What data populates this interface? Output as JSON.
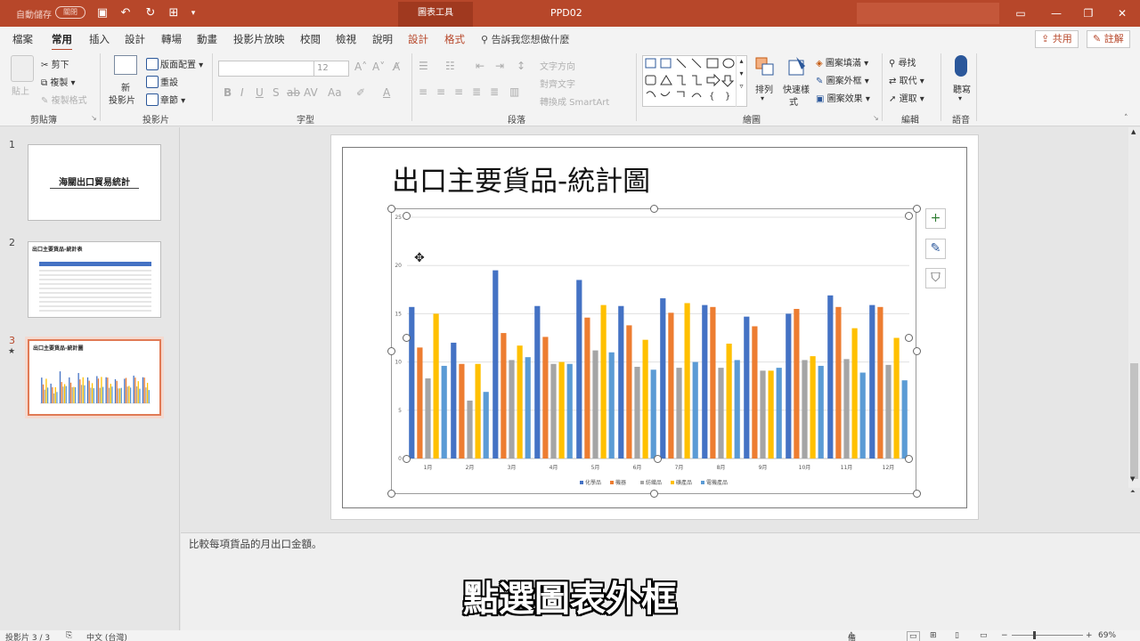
{
  "titlebar": {
    "autosave": "自動儲存",
    "autosave_state": "關閉",
    "context_tab": "圖表工具",
    "doc_title": "PPD02"
  },
  "menu": {
    "tabs": [
      "檔案",
      "常用",
      "插入",
      "設計",
      "轉場",
      "動畫",
      "投影片放映",
      "校閱",
      "檢視",
      "說明",
      "設計",
      "格式"
    ],
    "active": "常用",
    "tell_me": "告訴我您想做什麼",
    "share": "共用",
    "comment": "註解"
  },
  "ribbon": {
    "clipboard": {
      "paste": "貼上",
      "cut": "剪下",
      "copy": "複製",
      "format_painter": "複製格式",
      "label": "剪貼簿"
    },
    "slides": {
      "new_slide_1": "新",
      "new_slide_2": "投影片",
      "layout": "版面配置",
      "reset": "重設",
      "section": "章節",
      "label": "投影片"
    },
    "font": {
      "size": "12",
      "label": "字型"
    },
    "paragraph": {
      "text_direction": "文字方向",
      "align_text": "對齊文字",
      "smartart": "轉換成 SmartArt",
      "label": "段落"
    },
    "drawing": {
      "arrange": "排列",
      "quick_styles_1": "快速樣",
      "quick_styles_2": "式",
      "shape_fill": "圖案填滿",
      "shape_outline": "圖案外框",
      "shape_effects": "圖案效果",
      "label": "繪圖"
    },
    "editing": {
      "find": "尋找",
      "replace": "取代",
      "select": "選取",
      "label": "編輯"
    },
    "voice": {
      "dictate": "聽寫",
      "label": "語音"
    }
  },
  "thumbnails": [
    {
      "num": "1",
      "title": "海關出口貿易統計"
    },
    {
      "num": "2",
      "title": "出口主要貨品-統計表"
    },
    {
      "num": "3",
      "title": "出口主要貨品-統計圖"
    }
  ],
  "slide": {
    "title": "出口主要貨品-統計圖"
  },
  "chart_data": {
    "type": "bar",
    "categories": [
      "1月",
      "2月",
      "3月",
      "4月",
      "5月",
      "6月",
      "7月",
      "8月",
      "9月",
      "10月",
      "11月",
      "12月"
    ],
    "series": [
      {
        "name": "化學品",
        "color": "#4472c4",
        "values": [
          15.7,
          12.0,
          19.5,
          15.8,
          18.5,
          15.8,
          16.6,
          15.9,
          14.7,
          15.0,
          16.9,
          15.9
        ]
      },
      {
        "name": "機器",
        "color": "#ed7d31",
        "values": [
          11.5,
          9.8,
          13.0,
          12.6,
          14.6,
          13.8,
          15.1,
          15.7,
          13.7,
          15.5,
          15.7,
          15.7
        ]
      },
      {
        "name": "紡織品",
        "color": "#a5a5a5",
        "values": [
          8.3,
          6.0,
          10.2,
          9.8,
          11.2,
          9.5,
          9.4,
          9.4,
          9.1,
          10.2,
          10.3,
          9.7
        ]
      },
      {
        "name": "礦產品",
        "color": "#ffc000",
        "values": [
          15.0,
          9.8,
          11.7,
          10.0,
          15.9,
          12.3,
          16.1,
          11.9,
          9.1,
          10.6,
          13.5,
          12.5
        ]
      },
      {
        "name": "電機產品",
        "color": "#5b9bd5",
        "values": [
          9.6,
          6.9,
          10.5,
          9.8,
          11.0,
          9.2,
          10.0,
          10.2,
          9.4,
          9.6,
          8.9,
          8.1
        ]
      }
    ],
    "ylim": [
      0,
      25
    ],
    "yticks": [
      "0",
      "5",
      "10",
      "15",
      "20",
      "25"
    ],
    "grid": true,
    "legend": "bottom"
  },
  "notes": "比較每項貨品的月出口金額。",
  "subtitle": "點選圖表外框",
  "statusbar": {
    "slide_of": "投影片 3 / 3",
    "language": "中文 (台灣)",
    "notes_btn": "備忘稿",
    "zoom": "69%"
  }
}
